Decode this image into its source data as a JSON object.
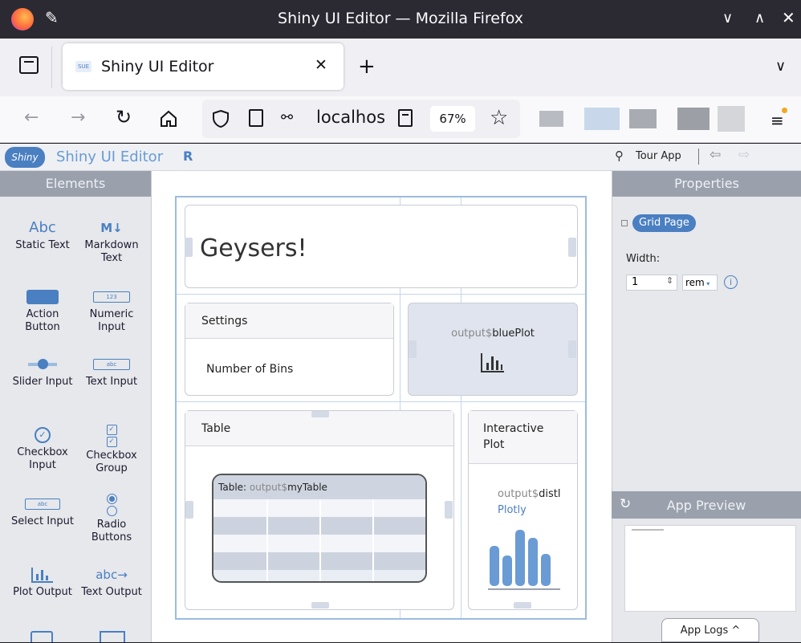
{
  "browser": {
    "window_title": "Shiny UI Editor — Mozilla Firefox",
    "tab_title": "Shiny UI Editor",
    "url": "localhos",
    "zoom": "67%"
  },
  "editor": {
    "logo": "Shiny",
    "title": "Shiny UI Editor",
    "tour_label": "Tour App",
    "elements_header": "Elements",
    "properties_header": "Properties",
    "elements": [
      {
        "icon": "Abc",
        "label": "Static Text"
      },
      {
        "icon": "M↓",
        "label": "Markdown Text"
      },
      {
        "icon": "",
        "label": "Action Button"
      },
      {
        "icon": "123",
        "label": "Numeric Input"
      },
      {
        "icon": "",
        "label": "Slider Input"
      },
      {
        "icon": "abc",
        "label": "Text Input"
      },
      {
        "icon": "✓",
        "label": "Checkbox Input"
      },
      {
        "icon": "✓",
        "label": "Checkbox Group"
      },
      {
        "icon": "abc",
        "label": "Select Input"
      },
      {
        "icon": "",
        "label": "Radio Buttons"
      },
      {
        "icon": "",
        "label": "Plot Output"
      },
      {
        "icon": "abc→",
        "label": "Text Output"
      }
    ],
    "properties": {
      "node_label": "Grid Page",
      "width_label": "Width:",
      "width_value": "1",
      "width_unit": "rem"
    },
    "app_preview_header": "App Preview",
    "app_logs_button": "App Logs ^"
  },
  "canvas": {
    "title": "Geysers!",
    "settings_header": "Settings",
    "settings_body": "Number of Bins",
    "blue_plot_prefix": "output$",
    "blue_plot_name": "bluePlot",
    "table_header": "Table",
    "table_label_prefix": "Table: ",
    "table_label_output": "output$",
    "table_label_name": "myTable",
    "interactive_header": "Interactive Plot",
    "dist_prefix": "output$",
    "dist_name": "distl",
    "dist_sub": "Plotly"
  },
  "colors": {
    "accent": "#4a7fc1",
    "grid_line": "#9bbce0",
    "panel_header": "#9aa1ad"
  }
}
